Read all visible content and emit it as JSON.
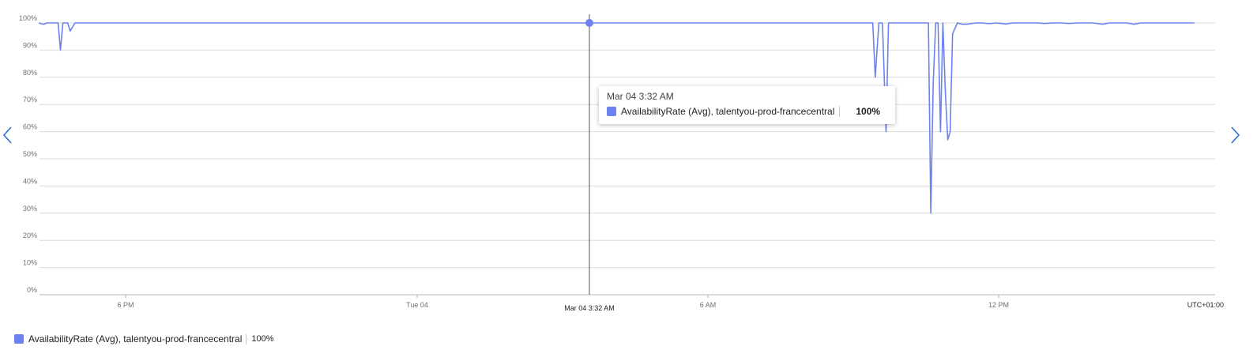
{
  "chart_data": {
    "type": "line",
    "y_unit": "percent",
    "ylim": [
      0,
      100
    ],
    "y_ticks": [
      "100%",
      "90%",
      "80%",
      "70%",
      "60%",
      "50%",
      "40%",
      "30%",
      "20%",
      "10%",
      "0%"
    ],
    "x_ticks": [
      "6 PM",
      "Tue 04",
      "6 AM",
      "12 PM"
    ],
    "timezone_label": "UTC+01:00",
    "grid": true,
    "legend_position": "bottom-left",
    "series": [
      {
        "name": "AvailabilityRate (Avg), talentyou-prod-francecentral",
        "color": "#6d82f0",
        "x_hours": [
          0,
          0.1,
          0.2,
          0.35,
          0.5,
          0.6,
          0.7,
          0.8,
          0.9,
          1.0,
          1.1,
          1.2,
          1.3,
          1.5,
          1.7,
          1.9,
          2.0,
          2.5,
          3,
          4,
          5,
          6,
          7,
          8,
          9,
          10,
          11,
          12,
          13,
          14,
          15,
          16,
          16.5,
          17,
          17.5,
          18,
          18.5,
          19,
          19.5,
          20,
          20.5,
          21,
          21.5,
          22,
          22.5,
          23,
          23.5,
          24,
          24.5,
          25,
          25.5,
          26,
          26.5,
          27,
          27.5,
          28,
          28.5,
          29,
          29.5,
          30,
          30.5,
          31,
          31.5,
          32,
          32.5,
          33,
          33.5,
          34,
          34.5,
          34.6,
          34.75,
          34.9,
          35.05,
          35.15,
          35.3,
          35.4,
          35.5,
          35.6,
          36,
          36.5,
          36.8,
          36.9,
          37.0,
          37.1,
          37.2,
          37.3,
          37.4,
          37.5,
          37.6,
          37.7,
          37.8,
          38.0,
          38.2,
          38.4,
          38.6,
          38.8,
          39,
          39.3,
          39.6,
          40,
          40.3,
          40.6,
          41,
          41.3,
          41.6,
          42,
          42.3,
          42.6,
          43,
          43.3,
          43.6,
          44,
          44.3,
          44.6,
          45,
          45.3,
          45.6,
          46,
          46.3,
          46.6,
          47,
          47.3,
          47.6,
          47.8
        ],
        "values": [
          100,
          99.7,
          99.5,
          100,
          100,
          100,
          100,
          100,
          90,
          100,
          100,
          100,
          97,
          100,
          100,
          100,
          100,
          100,
          100,
          100,
          100,
          100,
          100,
          100,
          100,
          100,
          100,
          100,
          100,
          100,
          100,
          100,
          100,
          100,
          100,
          100,
          100,
          100,
          100,
          100,
          100,
          100,
          100,
          100,
          100,
          100,
          100,
          100,
          100,
          100,
          100,
          100,
          100,
          100,
          100,
          100,
          100,
          100,
          100,
          100,
          100,
          100,
          100,
          100,
          100,
          100,
          100,
          100,
          100,
          80,
          100,
          100,
          60,
          100,
          100,
          100,
          100,
          100,
          100,
          100,
          100,
          30,
          78,
          100,
          100,
          60,
          100,
          75,
          57,
          60,
          96,
          100,
          99.5,
          99.5,
          99.8,
          100,
          100,
          99.7,
          100,
          99.6,
          100,
          100,
          100,
          100,
          99.8,
          100,
          100,
          99.8,
          100,
          100,
          100,
          99.5,
          100,
          100,
          100,
          99.5,
          100,
          100,
          100,
          100,
          100,
          100,
          100,
          100,
          100
        ]
      }
    ]
  },
  "hover": {
    "time_label": "Mar 04 3:32 AM",
    "series_name": "AvailabilityRate (Avg), talentyou-prod-francecentral",
    "value": "100%"
  },
  "cursor_axis_label": "Mar 04 3:32 AM",
  "legend": {
    "series_name": "AvailabilityRate (Avg), talentyou-prod-francecentral",
    "value": "100%"
  },
  "nav": {
    "prev_icon": "chevron-left-icon",
    "next_icon": "chevron-right-icon"
  },
  "colors": {
    "series": "#6d82f0",
    "grid": "#dcdcdc",
    "nav": "#2b6cd6"
  }
}
